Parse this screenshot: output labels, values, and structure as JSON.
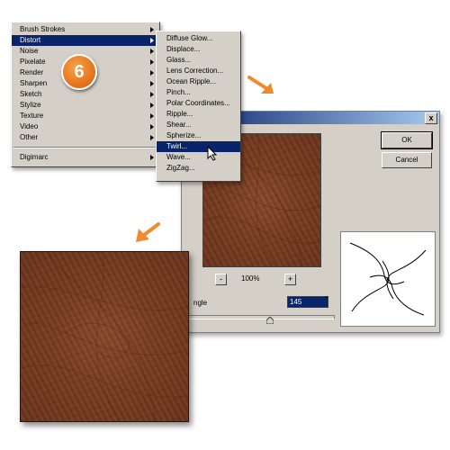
{
  "filter_menu": {
    "items": [
      {
        "label": "Brush Strokes",
        "submenu": true
      },
      {
        "label": "Distort",
        "submenu": true,
        "selected": true
      },
      {
        "label": "Noise",
        "submenu": true
      },
      {
        "label": "Pixelate",
        "submenu": true
      },
      {
        "label": "Render",
        "submenu": true
      },
      {
        "label": "Sharpen",
        "submenu": true
      },
      {
        "label": "Sketch",
        "submenu": true
      },
      {
        "label": "Stylize",
        "submenu": true
      },
      {
        "label": "Texture",
        "submenu": true
      },
      {
        "label": "Video",
        "submenu": true
      },
      {
        "label": "Other",
        "submenu": true
      }
    ],
    "bottom_item": {
      "label": "Digimarc",
      "submenu": true
    }
  },
  "distort_submenu": {
    "items": [
      {
        "label": "Diffuse Glow..."
      },
      {
        "label": "Displace..."
      },
      {
        "label": "Glass..."
      },
      {
        "label": "Lens Correction..."
      },
      {
        "label": "Ocean Ripple..."
      },
      {
        "label": "Pinch..."
      },
      {
        "label": "Polar Coordinates..."
      },
      {
        "label": "Ripple..."
      },
      {
        "label": "Shear..."
      },
      {
        "label": "Spherize..."
      },
      {
        "label": "Twirl...",
        "selected": true
      },
      {
        "label": "Wave..."
      },
      {
        "label": "ZigZag..."
      }
    ]
  },
  "step_badge": {
    "number": "6",
    "color": "#e8761d"
  },
  "twirl_dialog": {
    "close_label": "x",
    "ok_label": "OK",
    "cancel_label": "Cancel",
    "zoom_out_label": "-",
    "zoom_level": "100%",
    "zoom_in_label": "+",
    "angle_label": "ngle",
    "angle_value": "145",
    "degree_symbol": "°"
  },
  "colors": {
    "menu_bg": "#d4d0c8",
    "selection": "#0a246a",
    "wood": "#7a3e22",
    "arrow": "#f08a2a"
  },
  "icons": [
    "submenu-arrow-icon",
    "mouse-cursor-icon",
    "orange-arrow-icon",
    "twirl-preview-icon",
    "slider-thumb-icon"
  ]
}
